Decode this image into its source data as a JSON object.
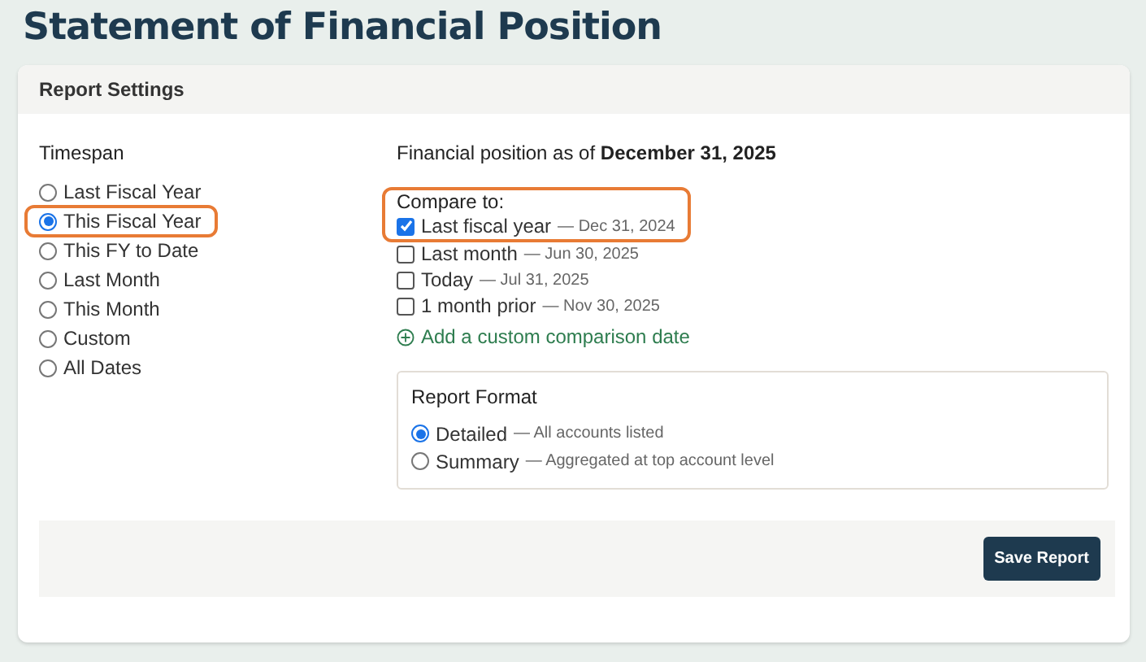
{
  "title": "Statement of Financial Position",
  "panel": {
    "title": "Report Settings"
  },
  "timespan": {
    "label": "Timespan",
    "options": [
      {
        "label": "Last Fiscal Year",
        "selected": false,
        "highlighted": false
      },
      {
        "label": "This Fiscal Year",
        "selected": true,
        "highlighted": true
      },
      {
        "label": "This FY to Date",
        "selected": false,
        "highlighted": false
      },
      {
        "label": "Last Month",
        "selected": false,
        "highlighted": false
      },
      {
        "label": "This Month",
        "selected": false,
        "highlighted": false
      },
      {
        "label": "Custom",
        "selected": false,
        "highlighted": false
      },
      {
        "label": "All Dates",
        "selected": false,
        "highlighted": false
      }
    ]
  },
  "position_as_of": "Financial position as of **December 31, 2025**",
  "compare": {
    "label": "Compare to:",
    "highlighted": true,
    "options": [
      {
        "label": "Last fiscal year",
        "date": "— Dec 31, 2024",
        "checked": true,
        "highlighted": true
      },
      {
        "label": "Last month",
        "date": "— Jun 30, 2025",
        "checked": false,
        "highlighted": false
      },
      {
        "label": "Today",
        "date": "— Jul 31, 2025",
        "checked": false,
        "highlighted": false
      },
      {
        "label": "1 month prior",
        "date": "— Nov 30, 2025",
        "checked": false,
        "highlighted": false
      }
    ],
    "add_link": "Add a custom comparison date"
  },
  "report_format": {
    "label": "Report Format",
    "options": [
      {
        "label": "Detailed",
        "description": "— All accounts listed",
        "selected": true
      },
      {
        "label": "Summary",
        "description": "— Aggregated at top account level",
        "selected": false
      }
    ]
  },
  "buttons": [
    {
      "label": "Save Report"
    }
  ]
}
